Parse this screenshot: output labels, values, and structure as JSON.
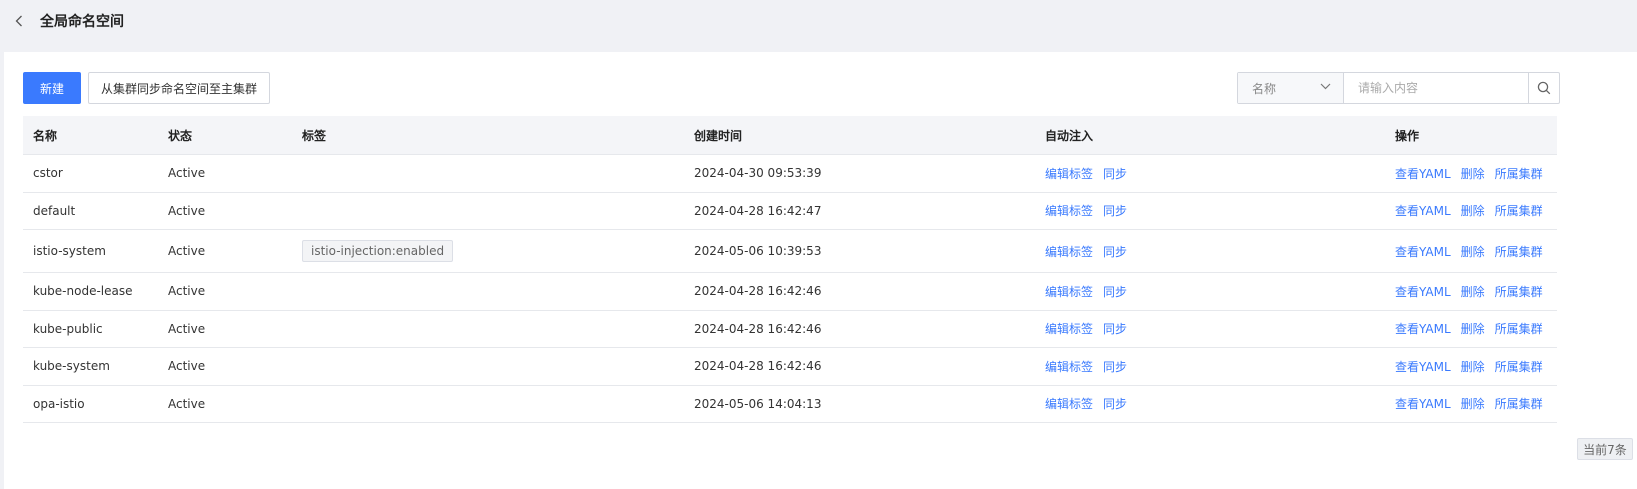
{
  "header": {
    "title": "全局命名空间"
  },
  "toolbar": {
    "new_label": "新建",
    "sync_label": "从集群同步命名空间至主集群",
    "search": {
      "field": "名称",
      "placeholder": "请输入内容"
    }
  },
  "table": {
    "columns": [
      "名称",
      "状态",
      "标签",
      "创建时间",
      "自动注入",
      "操作"
    ],
    "rows": [
      {
        "name": "cstor",
        "status": "Active",
        "label": "",
        "created": "2024-04-30 09:53:39"
      },
      {
        "name": "default",
        "status": "Active",
        "label": "",
        "created": "2024-04-28 16:42:47"
      },
      {
        "name": "istio-system",
        "status": "Active",
        "label": "istio-injection:enabled",
        "created": "2024-05-06 10:39:53"
      },
      {
        "name": "kube-node-lease",
        "status": "Active",
        "label": "",
        "created": "2024-04-28 16:42:46"
      },
      {
        "name": "kube-public",
        "status": "Active",
        "label": "",
        "created": "2024-04-28 16:42:46"
      },
      {
        "name": "kube-system",
        "status": "Active",
        "label": "",
        "created": "2024-04-28 16:42:46"
      },
      {
        "name": "opa-istio",
        "status": "Active",
        "label": "",
        "created": "2024-05-06 14:04:13"
      }
    ],
    "inject_actions": [
      "编辑标签",
      "同步"
    ],
    "ops_actions": [
      "查看YAML",
      "删除",
      "所属集群"
    ]
  },
  "footer": {
    "count": "当前7条"
  },
  "colors": {
    "primary": "#3a7afe",
    "background": "#f0f1f5"
  }
}
